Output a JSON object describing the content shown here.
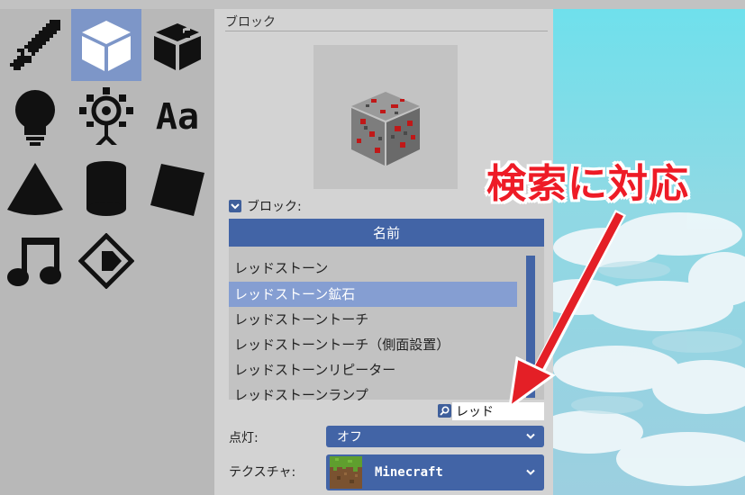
{
  "palette": {
    "icons": [
      "sword-icon",
      "block-icon",
      "chest-icon",
      "bulb-icon",
      "spotlight-icon",
      "text-icon",
      "cone-icon",
      "cylinder-icon",
      "plane-icon",
      "music-icon",
      "marker-icon"
    ],
    "text_icon_glyph": "Aa"
  },
  "panel": {
    "section_title": "ブロック",
    "block_checkbox_label": "ブロック:",
    "list_header": "名前",
    "items": [
      "レッドストーン",
      "レッドストーン鉱石",
      "レッドストーントーチ",
      "レッドストーントーチ（側面設置）",
      "レッドストーンリピーター",
      "レッドストーンランプ"
    ],
    "selected_item": "レッドストーン鉱石",
    "search_value": "レッド",
    "light_label": "点灯:",
    "light_value": "オフ",
    "texture_label": "テクスチャ:",
    "texture_value": "Minecraft"
  },
  "annotation": {
    "text": "検索に対応",
    "color": "#ee1b26"
  },
  "colors": {
    "accent": "#4264a6",
    "selected_bg": "#859ed2",
    "palette_selected": "#7d96c8"
  }
}
